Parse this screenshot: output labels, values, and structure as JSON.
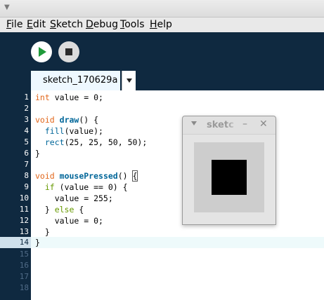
{
  "titlebar": {
    "menu_icon": "▼"
  },
  "menubar": {
    "items": [
      {
        "accel": "F",
        "rest": "ile"
      },
      {
        "accel": "E",
        "rest": "dit"
      },
      {
        "accel": "S",
        "rest": "ketch"
      },
      {
        "accel": "D",
        "rest": "ebug"
      },
      {
        "accel": "T",
        "rest": "ools"
      },
      {
        "accel": "H",
        "rest": "elp"
      }
    ]
  },
  "toolbar": {
    "run_icon": "play-icon",
    "stop_icon": "stop-icon"
  },
  "tabs": {
    "active_label": "sketch_170629a"
  },
  "editor": {
    "line_numbers": [
      "1",
      "2",
      "3",
      "4",
      "5",
      "6",
      "7",
      "8",
      "9",
      "10",
      "11",
      "12",
      "13",
      "14",
      "15",
      "16",
      "17",
      "18"
    ],
    "current_line": "14"
  },
  "code": {
    "l1_type": "int",
    "l1_rest": " value = 0;",
    "l3_type": "void",
    "l3_fn": "draw",
    "l3_rest": "() {",
    "l4_indent": "  ",
    "l4_fn": "fill",
    "l4_rest": "(value);",
    "l5_indent": "  ",
    "l5_fn": "rect",
    "l5_rest": "(25, 25, 50, 50);",
    "l6": "}",
    "l8_type": "void",
    "l8_fn": "mousePressed",
    "l8_rest": "() ",
    "l8_brace": "{",
    "l9_indent": "  ",
    "l9_kw": "if",
    "l9_rest": " (value == 0) {",
    "l10": "    value = 255;",
    "l11_a": "  } ",
    "l11_kw": "else",
    "l11_b": " {",
    "l12": "    value = 0;",
    "l13": "  }",
    "l14": "}"
  },
  "sketch_window": {
    "title": "sketc",
    "minimize_glyph": "–",
    "close_glyph": "✕",
    "background_color": "#cdcdcd",
    "fill_color": "#000000"
  },
  "colors": {
    "toolbar_bg": "#0f2940",
    "keyword_type": "#e2661a",
    "keyword_function": "#006699",
    "keyword_control": "#669900",
    "run_green": "#1f9a3a"
  }
}
